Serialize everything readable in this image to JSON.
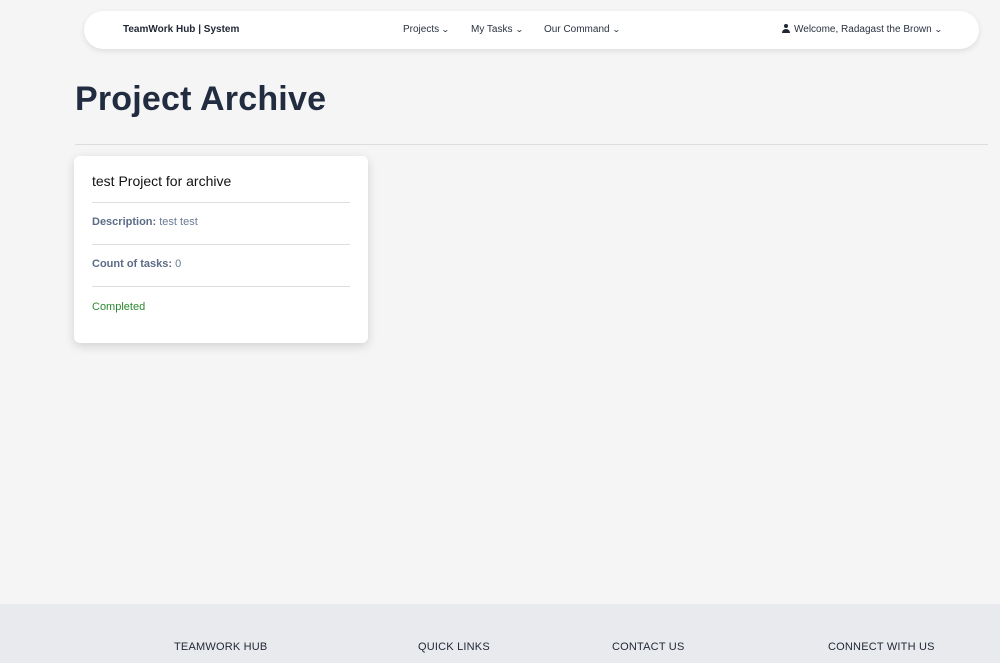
{
  "navbar": {
    "brand": "TeamWork Hub | System",
    "items": [
      {
        "label": "Projects"
      },
      {
        "label": "My Tasks"
      },
      {
        "label": "Our Command"
      }
    ],
    "user_label": "Welcome, Radagast the Brown",
    "chevron_icon": "chevron-down-icon",
    "user_icon": "user-icon"
  },
  "main": {
    "title": "Project Archive",
    "projects": [
      {
        "name": "test Project for archive",
        "description_label": "Description:",
        "description": "test test",
        "count_label": "Count of tasks:",
        "count": "0",
        "status": "Completed"
      }
    ]
  },
  "footer": {
    "headings": [
      "TEAMWORK HUB",
      "QUICK LINKS",
      "CONTACT US",
      "CONNECT WITH US"
    ]
  },
  "colors": {
    "status_completed": "#2a8a2f",
    "title": "#222c40",
    "background": "#f5f5f6",
    "footer_background": "#e8eaee"
  }
}
